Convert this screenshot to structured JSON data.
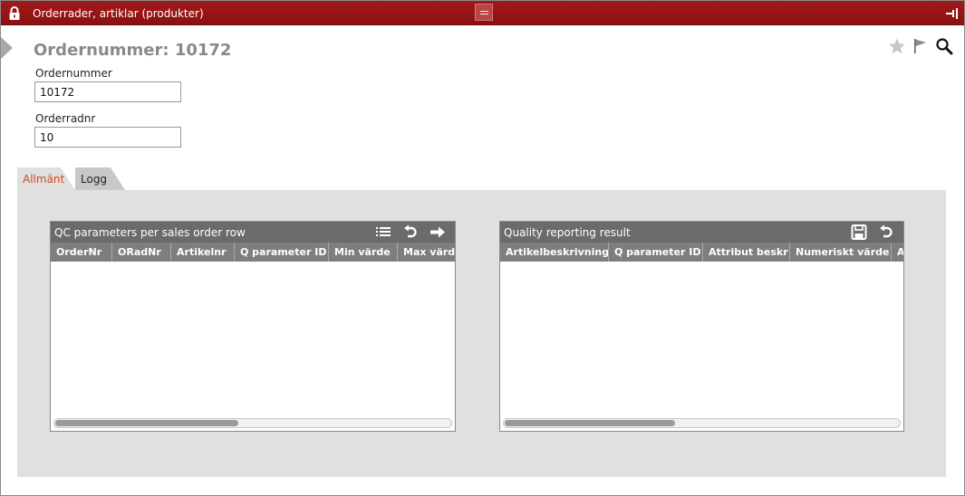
{
  "window": {
    "title": "Orderrader, artiklar (produkter)"
  },
  "header": {
    "page_title": "Ordernummer: 10172",
    "icons": [
      "star-icon",
      "flag-icon",
      "search-icon"
    ]
  },
  "form": {
    "ordernummer": {
      "label": "Ordernummer",
      "value": "10172"
    },
    "orderradnr": {
      "label": "Orderradnr",
      "value": "10"
    }
  },
  "tabs": [
    {
      "label": "Allmänt",
      "active": true
    },
    {
      "label": "Logg",
      "active": false
    }
  ],
  "panels": {
    "qc": {
      "title": "QC parameters per sales order row",
      "icons": [
        "list-icon",
        "undo-icon",
        "arrow-right-icon"
      ],
      "columns": [
        "OrderNr",
        "ORadNr",
        "Artikelnr",
        "Q parameter ID",
        "Min värde",
        "Max värde"
      ]
    },
    "quality": {
      "title": "Quality reporting result",
      "icons": [
        "save-icon",
        "undo-icon"
      ],
      "columns": [
        "Artikelbeskrivning",
        "Q parameter ID",
        "Attribut beskr",
        "Numeriskt värde",
        "A"
      ]
    }
  },
  "colors": {
    "titlebar": "#8c1010",
    "active_tab_text": "#d24a1a",
    "panel_header": "#6b6b6b",
    "column_header": "#7e7e7e"
  }
}
